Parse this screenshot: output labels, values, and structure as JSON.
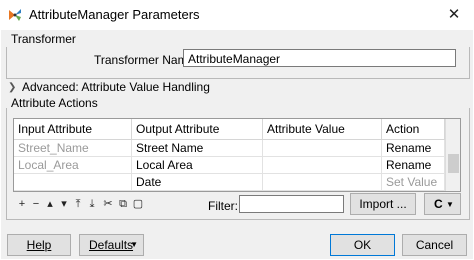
{
  "window": {
    "title": "AttributeManager Parameters",
    "close_glyph": "✕"
  },
  "transformer": {
    "section_label": "Transformer",
    "name_label": "Transformer Name:",
    "name_value": "AttributeManager"
  },
  "advanced": {
    "label": "Advanced: Attribute Value Handling"
  },
  "actions": {
    "section_label": "Attribute Actions",
    "columns": [
      "Input Attribute",
      "Output Attribute",
      "Attribute Value",
      "Action"
    ],
    "rows": [
      {
        "input": "Street_Name",
        "output": "Street Name",
        "value": "",
        "action": "Rename",
        "action_muted": false
      },
      {
        "input": "Local_Area",
        "output": "Local Area",
        "value": "",
        "action": "Rename",
        "action_muted": false
      },
      {
        "input": "",
        "output": "Date",
        "value": "",
        "action": "Set Value",
        "action_muted": true
      }
    ],
    "toolbar_icons": [
      "plus-icon",
      "minus-icon",
      "move-up-icon",
      "move-down-icon",
      "move-top-icon",
      "move-bottom-icon",
      "cut-icon",
      "copy-icon",
      "paste-icon"
    ],
    "toolbar_glyphs": [
      "+",
      "−",
      "▴",
      "▾",
      "⤒",
      "⤓",
      "✂",
      "⧉",
      "▢"
    ],
    "filter_label": "Filter:",
    "filter_value": "",
    "import_label": "Import ...",
    "refresh_glyph": "C"
  },
  "buttons": {
    "help": "Help",
    "defaults": "Defaults",
    "ok": "OK",
    "cancel": "Cancel"
  }
}
